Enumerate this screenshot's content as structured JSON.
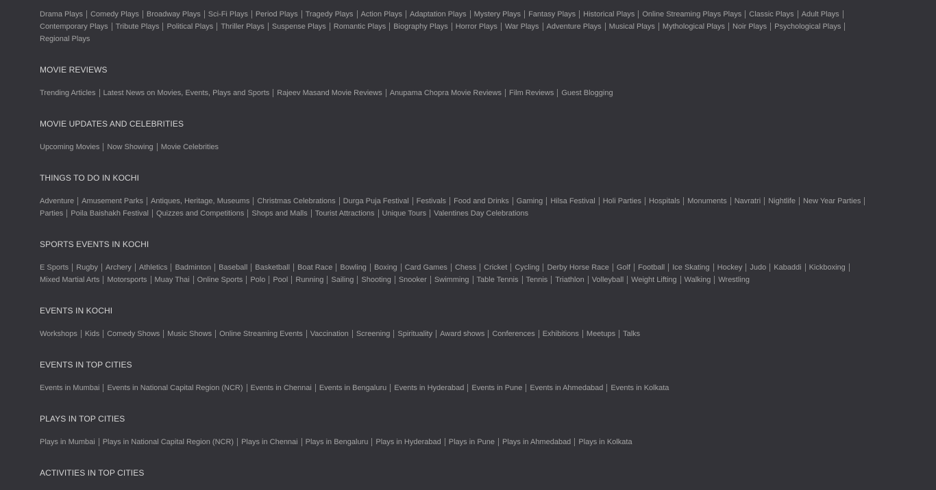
{
  "sections": [
    {
      "title": "",
      "links": [
        "Drama Plays",
        "Comedy Plays",
        "Broadway Plays",
        "Sci-Fi Plays",
        "Period Plays",
        "Tragedy Plays",
        "Action Plays",
        "Adaptation Plays",
        "Mystery Plays",
        "Fantasy Plays",
        "Historical Plays",
        "Online Streaming Plays Plays",
        "Classic Plays",
        "Adult Plays",
        "Contemporary Plays",
        "Tribute Plays",
        "Political Plays",
        "Thriller Plays",
        "Suspense Plays",
        "Romantic Plays",
        "Biography Plays",
        "Horror Plays",
        "War Plays",
        "Adventure Plays",
        "Musical Plays",
        "Mythological Plays",
        "Noir Plays",
        "Psychological Plays",
        "Regional Plays"
      ]
    },
    {
      "title": "MOVIE REVIEWS",
      "links": [
        "Trending Articles",
        "Latest News on Movies, Events, Plays and Sports",
        "Rajeev Masand Movie Reviews",
        "Anupama Chopra Movie Reviews",
        "Film Reviews",
        "Guest Blogging"
      ]
    },
    {
      "title": "MOVIE UPDATES AND CELEBRITIES",
      "links": [
        "Upcoming Movies",
        "Now Showing",
        "Movie Celebrities"
      ]
    },
    {
      "title": "THINGS TO DO IN KOCHI",
      "links": [
        "Adventure",
        "Amusement Parks",
        "Antiques, Heritage, Museums",
        "Christmas Celebrations",
        "Durga Puja Festival",
        "Festivals",
        "Food and Drinks",
        "Gaming",
        "Hilsa Festival",
        "Holi Parties",
        "Hospitals",
        "Monuments",
        "Navratri",
        "Nightlife",
        "New Year Parties",
        "Parties",
        "Poila Baishakh Festival",
        "Quizzes and Competitions",
        "Shops and Malls",
        "Tourist Attractions",
        "Unique Tours",
        "Valentines Day Celebrations"
      ]
    },
    {
      "title": "SPORTS EVENTS IN KOCHI",
      "links": [
        "E Sports",
        "Rugby",
        "Archery",
        "Athletics",
        "Badminton",
        "Baseball",
        "Basketball",
        "Boat Race",
        "Bowling",
        "Boxing",
        "Card Games",
        "Chess",
        "Cricket",
        "Cycling",
        "Derby Horse Race",
        "Golf",
        "Football",
        "Ice Skating",
        "Hockey",
        "Judo",
        "Kabaddi",
        "Kickboxing",
        "Mixed Martial Arts",
        "Motorsports",
        "Muay Thai",
        "Online Sports",
        "Polo",
        "Pool",
        "Running",
        "Sailing",
        "Shooting",
        "Snooker",
        "Swimming",
        "Table Tennis",
        "Tennis",
        "Triathlon",
        "Volleyball",
        "Weight Lifting",
        "Walking",
        "Wrestling"
      ]
    },
    {
      "title": "EVENTS IN KOCHI",
      "links": [
        "Workshops",
        "Kids",
        "Comedy Shows",
        "Music Shows",
        "Online Streaming Events",
        "Vaccination",
        "Screening",
        "Spirituality",
        "Award shows",
        "Conferences",
        "Exhibitions",
        "Meetups",
        "Talks"
      ]
    },
    {
      "title": "EVENTS IN TOP CITIES",
      "links": [
        "Events in Mumbai",
        "Events in National Capital Region (NCR)",
        "Events in Chennai",
        "Events in Bengaluru",
        "Events in Hyderabad",
        "Events in Pune",
        "Events in Ahmedabad",
        "Events in Kolkata"
      ]
    },
    {
      "title": "PLAYS IN TOP CITIES",
      "links": [
        "Plays in Mumbai",
        "Plays in National Capital Region (NCR)",
        "Plays in Chennai",
        "Plays in Bengaluru",
        "Plays in Hyderabad",
        "Plays in Pune",
        "Plays in Ahmedabad",
        "Plays in Kolkata"
      ]
    },
    {
      "title": "ACTIVITIES IN TOP CITIES",
      "links": []
    }
  ]
}
